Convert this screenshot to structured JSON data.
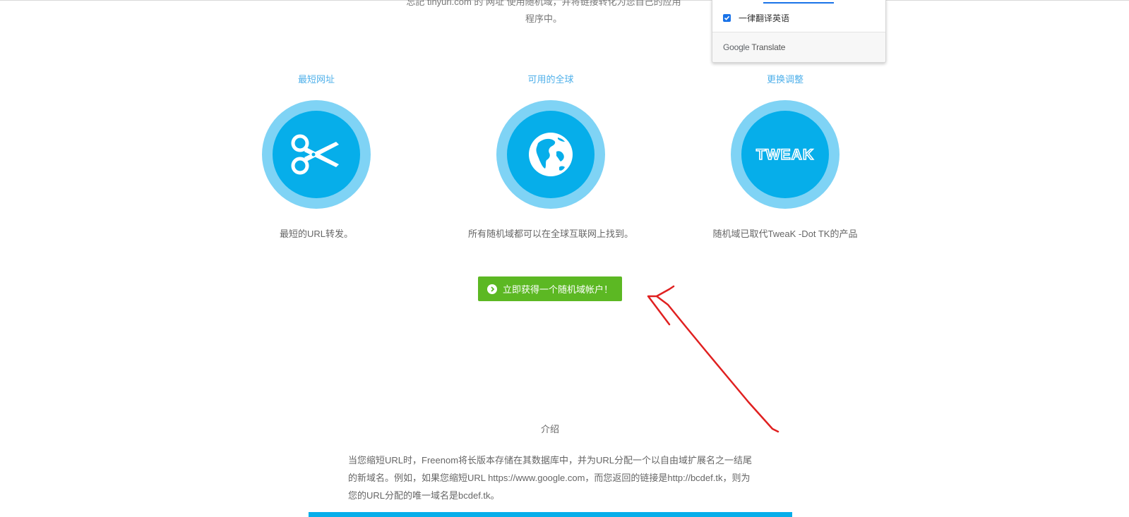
{
  "page": {
    "cut_text_line1": "忘記 tinyurl.com 的 网址 使用随机域，并将链接转化为您自己的应用",
    "cut_text_line2": "程序中。"
  },
  "features": [
    {
      "title": "最短网址",
      "icon": "scissors-icon",
      "desc": "最短的URL转发。"
    },
    {
      "title": "可用的全球",
      "icon": "globe-icon",
      "desc": "所有随机域都可以在全球互联网上找到。"
    },
    {
      "title": "更换调整",
      "icon": "tweak-logo",
      "logo_text": "TWEAK",
      "desc": "随机域已取代TweaK -Dot TK的产品"
    }
  ],
  "cta": {
    "label": "立即获得一个随机域帐户！",
    "icon": "chevron-circle-right-icon"
  },
  "intro": {
    "title": "介绍",
    "paragraph": "当您缩短URL时，Freenom将长版本存储在其数据库中，并为URL分配一个以自由域扩展名之一结尾的新域名。例如，如果您缩短URL https://www.google.com，而您返回的链接是http://bcdef.tk，则为您的URL分配的唯一域名是bcdef.tk。"
  },
  "translate_popup": {
    "checkbox_label": "一律翻译英语",
    "checkbox_checked": true,
    "brand_google": "Google",
    "brand_translate": "Translate"
  },
  "colors": {
    "accent_blue": "#06aeea",
    "light_blue": "#7fd3f5",
    "title_blue": "#4fb0ea",
    "cta_green": "#5cb823",
    "annotation_red": "#e02020"
  }
}
